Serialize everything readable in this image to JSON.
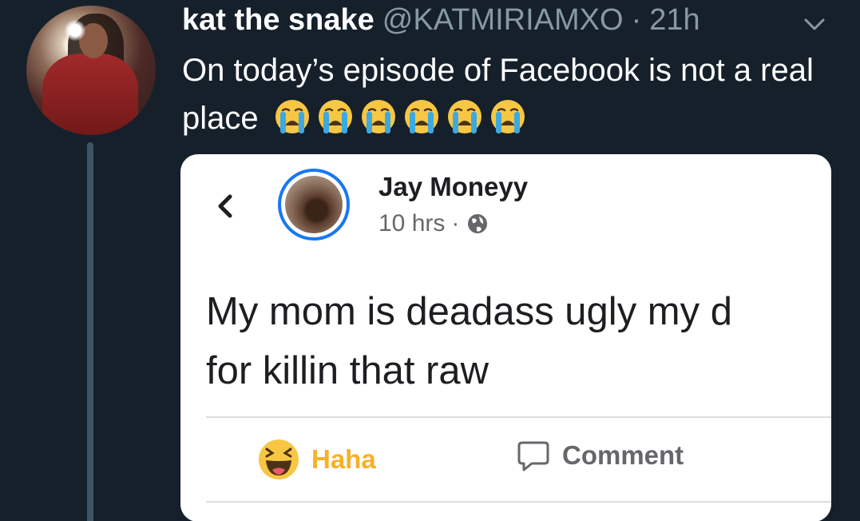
{
  "tweet": {
    "display_name": "kat the snake",
    "handle": "@KATMIRIAMXO",
    "separator": "·",
    "time": "21h",
    "text": "On today’s episode of Facebook is not a real place",
    "emojis": [
      "loudly-crying-face",
      "loudly-crying-face",
      "loudly-crying-face",
      "loudly-crying-face",
      "loudly-crying-face",
      "loudly-crying-face"
    ]
  },
  "facebook_post": {
    "author": "Jay Moneyy",
    "time": "10 hrs",
    "separator": "·",
    "text_line1": "My mom is deadass ugly my d",
    "text_line2": "for killin that raw",
    "reaction_label": "Haha",
    "comment_label": "Comment"
  },
  "colors": {
    "background": "#15202b",
    "muted": "#8899a6",
    "fb_blue": "#1877f2",
    "haha_yellow": "#f7b125"
  },
  "icons": {
    "menu": "chevron-down-icon",
    "back": "back-arrow-icon",
    "privacy": "globe-icon",
    "reaction": "haha-emoji-icon",
    "comment": "comment-bubble-icon"
  }
}
